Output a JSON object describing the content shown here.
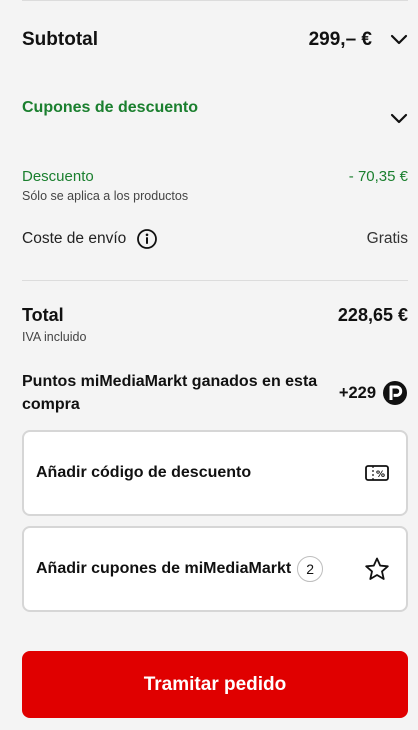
{
  "summary": {
    "subtotal_label": "Subtotal",
    "subtotal_value": "299,– €",
    "coupons_label": "Cupones de descuento",
    "discount_label": "Descuento",
    "discount_note": "Sólo se aplica a los productos",
    "discount_value": "- 70,35 €",
    "shipping_label": "Coste de envío",
    "shipping_value": "Gratis",
    "total_label": "Total",
    "total_note": "IVA incluido",
    "total_value": "228,65 €",
    "points_label": "Puntos miMediaMarkt ganados en esta compra",
    "points_value": "+229"
  },
  "actions": {
    "add_code_label": "Añadir código de descuento",
    "add_coupons_label": "Añadir cupones de miMediaMarkt",
    "coupons_count": "2",
    "checkout_label": "Tramitar pedido"
  },
  "colors": {
    "accent": "#e00000",
    "discount": "#1a7f2e"
  }
}
